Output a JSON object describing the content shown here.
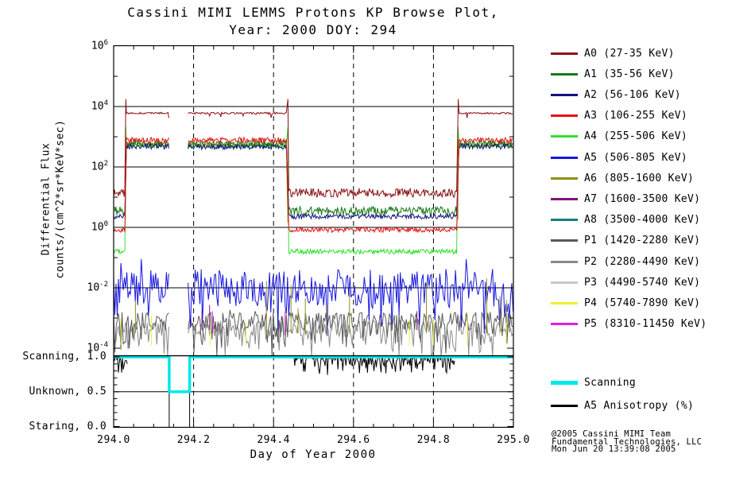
{
  "title": {
    "line1": "Cassini MIMI LEMMS Protons KP Browse Plot,",
    "line2": "Year: 2000 DOY: 294"
  },
  "axes": {
    "y_label_line1": "Differential Flux",
    "y_label_line2": "counts/(cm^2*sr*KeV*sec)",
    "y_tick_exponents": [
      6,
      4,
      2,
      0,
      -2,
      -4
    ],
    "x_label": "Day of Year 2000",
    "x_ticks": [
      {
        "label": "294.0",
        "value": 294.0
      },
      {
        "label": "294.2",
        "value": 294.2
      },
      {
        "label": "294.4",
        "value": 294.4
      },
      {
        "label": "294.6",
        "value": 294.6
      },
      {
        "label": "294.8",
        "value": 294.8
      },
      {
        "label": "295.0",
        "value": 295.0
      }
    ]
  },
  "mode_panel": {
    "labels": [
      {
        "text": "Scanning, 1.0",
        "value": 1.0
      },
      {
        "text": "Unknown, 0.5",
        "value": 0.5
      },
      {
        "text": "Staring, 0.0",
        "value": 0.0
      }
    ]
  },
  "legend": {
    "channels": [
      {
        "id": "A0",
        "label": "A0 (27-35 KeV)",
        "color": "#8B1212"
      },
      {
        "id": "A1",
        "label": "A1 (35-56 KeV)",
        "color": "#177817"
      },
      {
        "id": "A2",
        "label": "A2 (56-106 KeV)",
        "color": "#12127F"
      },
      {
        "id": "A3",
        "label": "A3 (106-255 KeV)",
        "color": "#E31414"
      },
      {
        "id": "A4",
        "label": "A4 (255-506 KeV)",
        "color": "#2EE02E"
      },
      {
        "id": "A5",
        "label": "A5 (506-805 KeV)",
        "color": "#1616DD"
      },
      {
        "id": "A6",
        "label": "A6 (805-1600 KeV)",
        "color": "#8F8F14"
      },
      {
        "id": "A7",
        "label": "A7 (1600-3500 KeV)",
        "color": "#801480"
      },
      {
        "id": "A8",
        "label": "A8 (3500-4000 KeV)",
        "color": "#128080"
      },
      {
        "id": "P1",
        "label": "P1 (1420-2280 KeV)",
        "color": "#5A5A5A"
      },
      {
        "id": "P2",
        "label": "P2 (2280-4490 KeV)",
        "color": "#8A8A8A"
      },
      {
        "id": "P3",
        "label": "P3 (4490-5740 KeV)",
        "color": "#C8C8C8"
      },
      {
        "id": "P4",
        "label": "P4 (5740-7890 KeV)",
        "color": "#F0F030"
      },
      {
        "id": "P5",
        "label": "P5 (8310-11450 KeV)",
        "color": "#E020E0"
      }
    ],
    "extra": [
      {
        "id": "scanning",
        "label": "Scanning",
        "color": "#00E8E8",
        "thickness": 5
      },
      {
        "id": "a5-anisotropy",
        "label": "A5 Anisotropy (%)",
        "color": "#000000",
        "thickness": 3
      }
    ]
  },
  "credit": {
    "line1": "@2005 Cassini MIMI Team",
    "line2": "Fundamental Technologies, LLC",
    "line3": "Mon Jun 20 13:39:08 2005"
  },
  "chart_data": {
    "type": "line",
    "title": "Cassini MIMI LEMMS Protons KP Browse Plot, Year: 2000 DOY: 294",
    "x_label": "Day of Year 2000",
    "y_label": "Differential Flux counts/(cm^2*sr*KeV*sec)",
    "x_range": [
      294.0,
      295.0
    ],
    "x_tick_step": 0.2,
    "y_scale": "log10",
    "y_exp_range": [
      -4,
      6
    ],
    "grid": {
      "h_solid_exps": [
        4,
        2,
        0,
        -2
      ],
      "v_dashed_x": [
        294.2,
        294.4,
        294.6,
        294.8
      ]
    },
    "data_gap": [
      294.139,
      294.186
    ],
    "mode_segments": [
      {
        "mode": "low",
        "range": [
          294.0,
          294.029
        ]
      },
      {
        "mode": "high",
        "range": [
          294.032,
          294.139
        ]
      },
      {
        "mode": "gap",
        "range": [
          294.139,
          294.186
        ]
      },
      {
        "mode": "high",
        "range": [
          294.186,
          294.434
        ]
      },
      {
        "mode": "low",
        "range": [
          294.438,
          294.86
        ]
      },
      {
        "mode": "high",
        "range": [
          294.864,
          295.0
        ]
      }
    ],
    "band_series": [
      {
        "name": "A4",
        "color": "#2EE02E",
        "high": 2.71,
        "low": -0.8,
        "amp_high": 0.08,
        "amp_low": 0.08,
        "spike_top": 3.32
      },
      {
        "name": "A6",
        "color": "#8F8F14",
        "high": 2.73,
        "low": null,
        "amp_high": 0.08,
        "amp_low": 0.0,
        "spike_top": 2.85
      },
      {
        "name": "A1",
        "color": "#177817",
        "high": 2.78,
        "low": 0.54,
        "amp_high": 0.1,
        "amp_low": 0.15,
        "spike_top": null
      },
      {
        "name": "A2",
        "color": "#12127F",
        "high": 2.67,
        "low": 0.36,
        "amp_high": 0.09,
        "amp_low": 0.08,
        "spike_top": null
      },
      {
        "name": "A3",
        "color": "#E31414",
        "high": 2.88,
        "low": -0.08,
        "amp_high": 0.1,
        "amp_low": 0.08,
        "spike_top": null
      },
      {
        "name": "A0",
        "color": "#8B1212",
        "high": 3.78,
        "low": 1.15,
        "amp_high": 0.03,
        "amp_low": 0.15,
        "spike_top": 4.25
      }
    ],
    "noise_series": [
      {
        "name": "P2",
        "color": "#8A8A8A",
        "center": -3.35,
        "spread": 0.28,
        "down_extra": 0.95,
        "clamp": [
          -4.25,
          -2.95
        ]
      },
      {
        "name": "P1",
        "color": "#5A5A5A",
        "center": -3.1,
        "spread": 0.3,
        "down_extra": 1.05,
        "clamp": [
          -4.25,
          -2.55
        ]
      },
      {
        "name": "A5",
        "color": "#1616DD",
        "center": -2.0,
        "spread": 0.62,
        "down_extra": 1.15,
        "clamp": [
          -3.6,
          -1.05
        ]
      }
    ],
    "spike_events": [
      {
        "name": "A6",
        "color": "#8F8F14",
        "base": -3.5,
        "top_range": [
          -2.7,
          -1.6
        ],
        "count": 11
      },
      {
        "name": "P4",
        "color": "#F0F030",
        "base": -3.9,
        "top_range": [
          -3.2,
          -2.5
        ],
        "count": 8
      },
      {
        "name": "A7",
        "color": "#801480",
        "base": -3.4,
        "top_range": [
          -2.8,
          -2.3
        ],
        "count": 3
      },
      {
        "name": "P5",
        "color": "#E020E0",
        "base": -3.5,
        "top_range": [
          -2.9,
          -2.5
        ],
        "count": 2
      }
    ],
    "scanning": {
      "color": "#00E8E8",
      "default": 1.0,
      "dip": {
        "range": [
          294.139,
          294.19
        ],
        "value": 0.5
      }
    },
    "anisotropy": {
      "color": "#000000",
      "segments": [
        [
          294.0,
          294.036
        ],
        [
          294.451,
          294.855
        ]
      ],
      "min": 0.75,
      "max": 1.0
    }
  }
}
